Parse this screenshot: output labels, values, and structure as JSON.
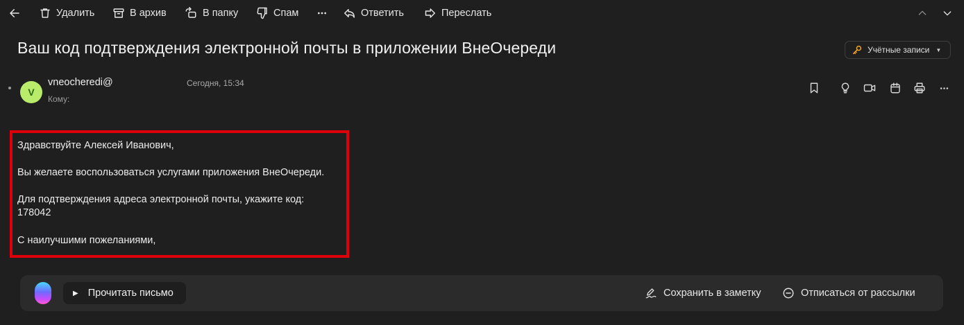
{
  "toolbar": {
    "delete_label": "Удалить",
    "archive_label": "В архив",
    "folder_label": "В папку",
    "spam_label": "Спам",
    "more_icon": "more-horizontal-icon",
    "reply_label": "Ответить",
    "forward_label": "Переслать"
  },
  "message": {
    "subject": "Ваш код подтверждения электронной почты в приложении ВнеОчереди",
    "accounts_label": "Учётные записи",
    "sender": {
      "avatar_letter": "V",
      "name": "vneocheredi@",
      "to_label": "Кому:",
      "date": "Сегодня, 15:34"
    },
    "body": {
      "greeting": "Здравствуйте Алексей Иванович,",
      "line1": "Вы желаете воспользоваться услугами приложения ВнеОчереди.",
      "line2": "Для подтверждения адреса электронной почты, укажите код:",
      "code": "178042",
      "closing": "С наилучшими пожеланиями,"
    }
  },
  "bottom_bar": {
    "read_label": "Прочитать письмо",
    "save_note_label": "Сохранить в заметку",
    "unsubscribe_label": "Отписаться от рассылки"
  },
  "colors": {
    "background": "#1f1f1f",
    "highlight_border": "#e0000a",
    "avatar_bg": "#b9ec6b",
    "accent_key": "#f5a623"
  }
}
